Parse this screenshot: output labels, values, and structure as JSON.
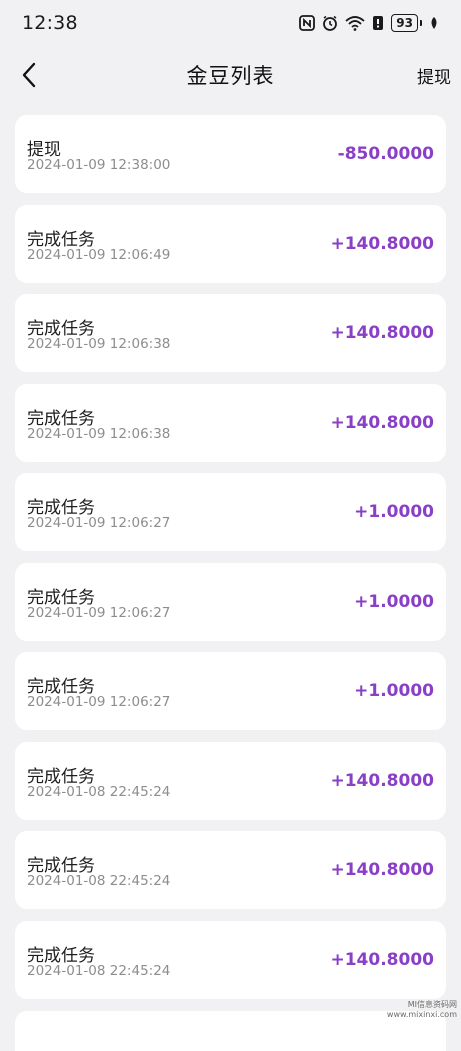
{
  "status": {
    "time": "12:38",
    "battery": "93",
    "icons": [
      "nfc-icon",
      "alarm-icon",
      "wifi-icon",
      "notification-icon",
      "battery-icon",
      "leaf-icon"
    ]
  },
  "nav": {
    "title": "金豆列表",
    "action": "提现",
    "back_icon": "chevron-left-icon"
  },
  "colors": {
    "amount": "#8a3fc7",
    "background": "#f1f1f3",
    "card": "#ffffff"
  },
  "items": [
    {
      "title": "提现",
      "time": "2024-01-09 12:38:00",
      "amount": "-850.0000"
    },
    {
      "title": "完成任务",
      "time": "2024-01-09 12:06:49",
      "amount": "+140.8000"
    },
    {
      "title": "完成任务",
      "time": "2024-01-09 12:06:38",
      "amount": "+140.8000"
    },
    {
      "title": "完成任务",
      "time": "2024-01-09 12:06:38",
      "amount": "+140.8000"
    },
    {
      "title": "完成任务",
      "time": "2024-01-09 12:06:27",
      "amount": "+1.0000"
    },
    {
      "title": "完成任务",
      "time": "2024-01-09 12:06:27",
      "amount": "+1.0000"
    },
    {
      "title": "完成任务",
      "time": "2024-01-09 12:06:27",
      "amount": "+1.0000"
    },
    {
      "title": "完成任务",
      "time": "2024-01-08 22:45:24",
      "amount": "+140.8000"
    },
    {
      "title": "完成任务",
      "time": "2024-01-08 22:45:24",
      "amount": "+140.8000"
    },
    {
      "title": "完成任务",
      "time": "2024-01-08 22:45:24",
      "amount": "+140.8000"
    }
  ],
  "watermark": {
    "line1": "MI信息资码网",
    "line2": "www.mixinxi.com"
  }
}
